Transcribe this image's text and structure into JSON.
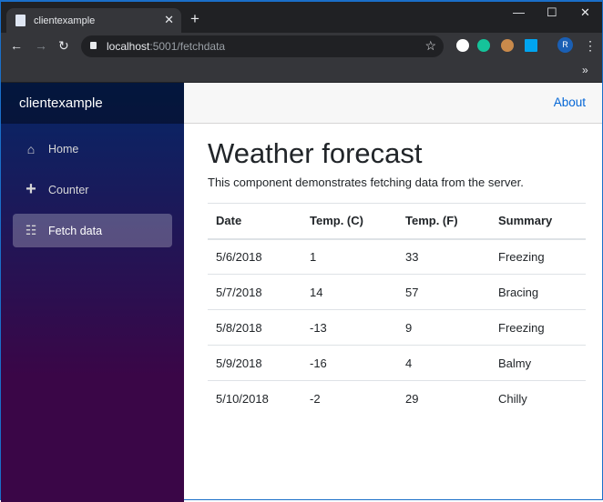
{
  "browser": {
    "tab_title": "clientexample",
    "url_host": "localhost",
    "url_path": ":5001/fetchdata",
    "profile_initial": "R"
  },
  "sidebar": {
    "brand": "clientexample",
    "items": [
      {
        "label": "Home",
        "icon": "home-icon"
      },
      {
        "label": "Counter",
        "icon": "plus-icon"
      },
      {
        "label": "Fetch data",
        "icon": "list-icon",
        "active": true
      }
    ]
  },
  "topbar": {
    "about": "About"
  },
  "page": {
    "title": "Weather forecast",
    "description": "This component demonstrates fetching data from the server."
  },
  "table": {
    "headers": [
      "Date",
      "Temp. (C)",
      "Temp. (F)",
      "Summary"
    ],
    "rows": [
      [
        "5/6/2018",
        "1",
        "33",
        "Freezing"
      ],
      [
        "5/7/2018",
        "14",
        "57",
        "Bracing"
      ],
      [
        "5/8/2018",
        "-13",
        "9",
        "Freezing"
      ],
      [
        "5/9/2018",
        "-16",
        "4",
        "Balmy"
      ],
      [
        "5/10/2018",
        "-2",
        "29",
        "Chilly"
      ]
    ]
  }
}
